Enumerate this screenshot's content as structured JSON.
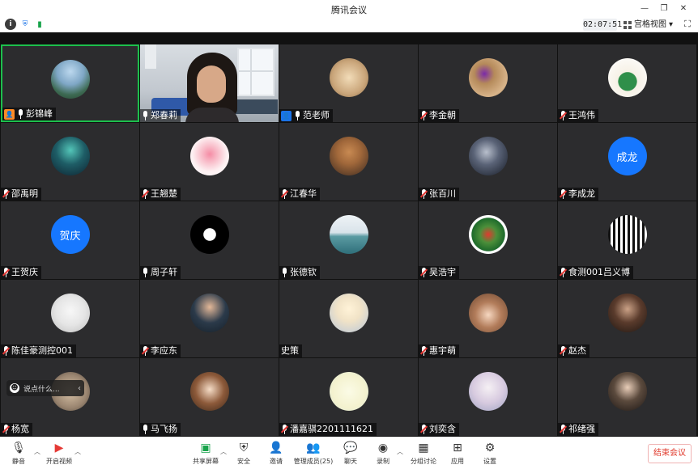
{
  "window": {
    "title": "腾讯会议",
    "controls": [
      "minimize-icon",
      "restore-icon",
      "close-icon"
    ]
  },
  "status": {
    "icons": [
      "info-icon",
      "shield-icon",
      "signal-icon"
    ],
    "timer": "02:07:51",
    "view_label": "宫格视图"
  },
  "participants": [
    {
      "name": "彭锦峰",
      "mic": "on",
      "badge": "host",
      "avatar": {
        "type": "photo",
        "theme": "coast"
      }
    },
    {
      "name": "郑春莉",
      "mic": "on",
      "badge": "",
      "avatar": {
        "type": "video"
      }
    },
    {
      "name": "范老师",
      "mic": "on",
      "badge": "cohost",
      "avatar": {
        "type": "photo",
        "theme": "buddha"
      }
    },
    {
      "name": "李金朝",
      "mic": "muted",
      "badge": "",
      "avatar": {
        "type": "photo",
        "theme": "dog"
      }
    },
    {
      "name": "王鸿伟",
      "mic": "muted",
      "badge": "",
      "avatar": {
        "type": "photo",
        "theme": "cartoon-kid"
      }
    },
    {
      "name": "邵禹明",
      "mic": "muted",
      "badge": "",
      "avatar": {
        "type": "photo",
        "theme": "aurora"
      }
    },
    {
      "name": "王翘楚",
      "mic": "muted",
      "badge": "",
      "avatar": {
        "type": "photo",
        "theme": "tulip"
      }
    },
    {
      "name": "江春华",
      "mic": "muted",
      "badge": "",
      "avatar": {
        "type": "photo",
        "theme": "meme-dog"
      }
    },
    {
      "name": "张百川",
      "mic": "muted",
      "badge": "",
      "avatar": {
        "type": "photo",
        "theme": "dragon"
      }
    },
    {
      "name": "李成龙",
      "mic": "muted",
      "badge": "",
      "avatar": {
        "type": "text",
        "text": "成龙"
      }
    },
    {
      "name": "王贺庆",
      "mic": "muted",
      "badge": "",
      "avatar": {
        "type": "text",
        "text": "贺庆"
      }
    },
    {
      "name": "周子轩",
      "mic": "on",
      "badge": "",
      "avatar": {
        "type": "photo",
        "theme": "logo"
      }
    },
    {
      "name": "张德钦",
      "mic": "on",
      "badge": "",
      "avatar": {
        "type": "photo",
        "theme": "sea"
      }
    },
    {
      "name": "吴浩宇",
      "mic": "muted",
      "badge": "",
      "avatar": {
        "type": "photo",
        "theme": "mario"
      }
    },
    {
      "name": "食测001吕义博",
      "mic": "muted",
      "badge": "",
      "avatar": {
        "type": "photo",
        "theme": "qr"
      }
    },
    {
      "name": "陈佳豪测控001",
      "mic": "muted",
      "badge": "",
      "avatar": {
        "type": "photo",
        "theme": "panda-meme"
      }
    },
    {
      "name": "李应东",
      "mic": "muted",
      "badge": "",
      "avatar": {
        "type": "photo",
        "theme": "suit"
      }
    },
    {
      "name": "史策",
      "mic": "none",
      "badge": "",
      "avatar": {
        "type": "photo",
        "theme": "anime-knight"
      }
    },
    {
      "name": "惠宇萌",
      "mic": "muted",
      "badge": "",
      "avatar": {
        "type": "photo",
        "theme": "cartoon-girl"
      }
    },
    {
      "name": "赵杰",
      "mic": "muted",
      "badge": "",
      "avatar": {
        "type": "photo",
        "theme": "child"
      }
    },
    {
      "name": "杨宽",
      "mic": "muted",
      "badge": "",
      "avatar": {
        "type": "photo",
        "theme": "blurred"
      }
    },
    {
      "name": "马飞扬",
      "mic": "on",
      "badge": "",
      "avatar": {
        "type": "photo",
        "theme": "chibi"
      }
    },
    {
      "name": "潘嘉骐2201111621",
      "mic": "muted",
      "badge": "",
      "avatar": {
        "type": "photo",
        "theme": "pale"
      }
    },
    {
      "name": "刘奕含",
      "mic": "muted",
      "badge": "",
      "avatar": {
        "type": "photo",
        "theme": "anime-boy"
      }
    },
    {
      "name": "祁绪强",
      "mic": "muted",
      "badge": "",
      "avatar": {
        "type": "photo",
        "theme": "portrait"
      }
    }
  ],
  "chat": {
    "placeholder": "说点什么...",
    "icon": "smile-icon"
  },
  "toolbar": {
    "mute": "静音",
    "video": "开启视频",
    "share": "共享屏幕",
    "security": "安全",
    "invite": "邀请",
    "members": "管理成员(25)",
    "chat": "聊天",
    "record": "录制",
    "breakout": "分组讨论",
    "apps": "应用",
    "settings": "设置",
    "end": "结束会议"
  },
  "colors": {
    "active_border": "#1dbf4c",
    "tile_bg": "#2c2c2e",
    "host_badge": "#ff8b26",
    "cohost_badge": "#1a73e8",
    "text_avatar": "#1677ff",
    "end_text": "#e0392b"
  }
}
